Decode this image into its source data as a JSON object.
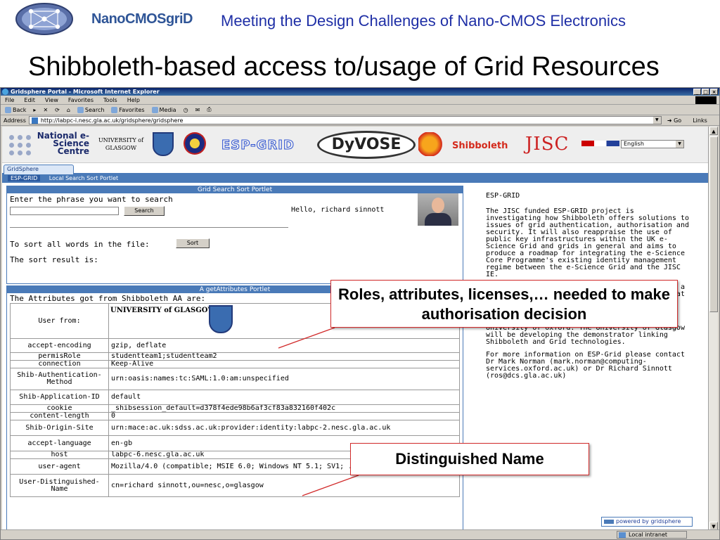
{
  "slide": {
    "brand": "NanoCMOSgriD",
    "subtitle": "Meeting the Design Challenges of Nano-CMOS Electronics",
    "title": "Shibboleth-based access to/usage of Grid Resources"
  },
  "browser": {
    "window_title": "Gridsphere Portal - Microsoft Internet Explorer",
    "menu": [
      "File",
      "Edit",
      "View",
      "Favorites",
      "Tools",
      "Help"
    ],
    "toolbar": [
      "Back",
      "Search",
      "Favorites",
      "Media"
    ],
    "address_label": "Address",
    "url": "http://labpc-i.nesc.gla.ac.uk/gridsphere/gridsphere",
    "go_label": "Go",
    "links_label": "Links",
    "status_zone": "Local intranet"
  },
  "banner": {
    "nesc": "National e-Science Centre",
    "university": "UNIVERSITY of GLASGOW",
    "esp": "ESP-GRID",
    "dyvose": "DyVOSE",
    "shibboleth": "Shibboleth",
    "jisc": "JISC",
    "language": "English"
  },
  "tabs": {
    "main": "GridSphere",
    "sub": [
      "ESP-GRID",
      "Local Search Sort Portlet"
    ]
  },
  "search_portlet": {
    "title": "Grid Search Sort Portlet",
    "prompt": "Enter the phrase you want to search",
    "search_button": "Search",
    "greeting": "Hello, richard sinnott",
    "sort_label": "To sort all words in the file:",
    "sort_button": "Sort",
    "result_label": "The sort result is:"
  },
  "attr_portlet": {
    "title": "A getAttributes Portlet",
    "intro": "The Attributes got from Shibboleth AA are:",
    "user_from_label": "User from:",
    "logo_text": "UNIVERSITY of GLASGOW",
    "rows": [
      {
        "key": "accept-encoding",
        "value": "gzip, deflate"
      },
      {
        "key": "permisRole",
        "value": "studentteam1;studentteam2"
      },
      {
        "key": "connection",
        "value": "Keep-Alive"
      },
      {
        "key": "Shib-Authentication-Method",
        "value": "urn:oasis:names:tc:SAML:1.0:am:unspecified"
      },
      {
        "key": "Shib-Application-ID",
        "value": "default"
      },
      {
        "key": "cookie",
        "value": "_shibsession_default=d378f4ede98b6af3cf83a832160f402c"
      },
      {
        "key": "content-length",
        "value": "0"
      },
      {
        "key": "Shib-Origin-Site",
        "value": "urn:mace:ac.uk:sdss.ac.uk:provider:identity:labpc-2.nesc.gla.ac.uk"
      },
      {
        "key": "accept-language",
        "value": "en-gb"
      },
      {
        "key": "host",
        "value": "labpc-6.nesc.gla.ac.uk"
      },
      {
        "key": "user-agent",
        "value": "Mozilla/4.0 (compatible; MSIE 6.0; Windows NT 5.1; SV1; .NET CLR 1.1.4322)"
      },
      {
        "key": "User-Distinguished-Name",
        "value": "cn=richard sinnott,ou=nesc,o=glasgow"
      }
    ]
  },
  "right_col": {
    "heading": "ESP-GRID",
    "para1": "The JISC funded ESP-GRID project is investigating how Shibboleth offers solutions to issues of grid authentication, authorisation and security. It will also reappraise the use of public key infrastructures within the UK e-Science Grid and grids in general and aims to produce a roadmap for integrating the e-Science Core Programme's existing identity management regime between the e-Science Grid and the JISC IE.",
    "para2": "The overall aim of this project is to achieve a deeper understanding of the potential role that Shibboleth can play in grid authentication, authorization and security.",
    "para3": "ESP-Grid is lead by Dr Mark Norman at the University of Oxford. The University of Glasgow will be developing the demonstrator linking Shibboleth and Grid technologies.",
    "para4": "For more information on ESP-Grid please contact Dr Mark Norman (mark.norman@computing-services.oxford.ac.uk) or Dr Richard Sinnott (ros@dcs.gla.ac.uk)",
    "powered_by": "powered by gridsphere"
  },
  "callouts": {
    "roles": "Roles, attributes, licenses,… needed to make authorisation decision",
    "dn": "Distinguished Name"
  }
}
